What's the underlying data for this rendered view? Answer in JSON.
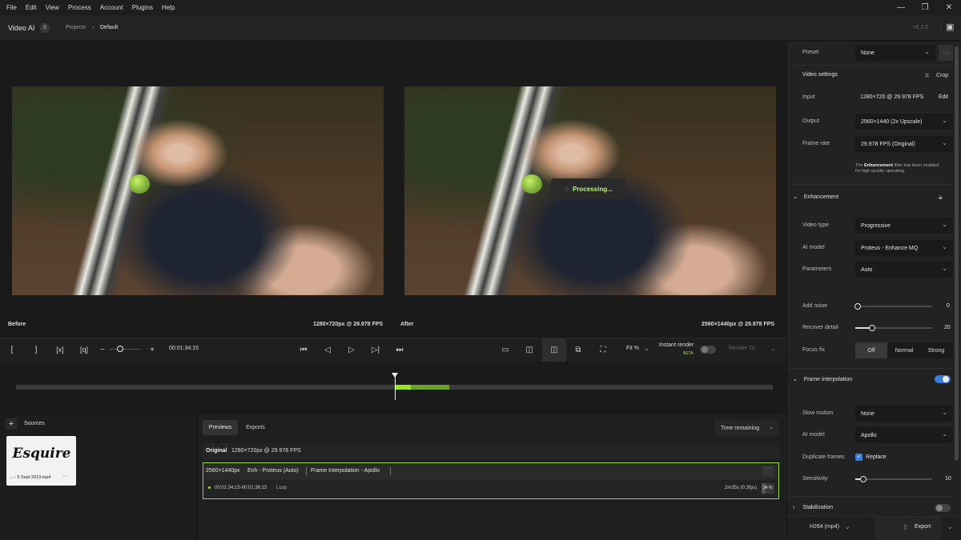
{
  "menu": [
    "File",
    "Edit",
    "View",
    "Process",
    "Account",
    "Plugins",
    "Help"
  ],
  "app": {
    "title": "Video AI",
    "badge": "5",
    "version": "v5.2.0"
  },
  "breadcrumb": {
    "projects": "Projects",
    "current": "Default"
  },
  "viewer": {
    "before_label": "Before",
    "before_res": "1280×720px @ 29.978 FPS",
    "after_label": "After",
    "after_res": "2560×1440px @ 29.978 FPS",
    "processing": "Processing..."
  },
  "controls": {
    "timecode": "00:01:34;15",
    "fit": "Fit %",
    "instant_render": "Instant render",
    "beta": "BETA",
    "render": "Render 2s"
  },
  "timeline": {
    "playhead": 0.5,
    "processed_fraction": 0.3
  },
  "sources": {
    "title": "Sources",
    "file": "... - 5 Sept 2013.mp4",
    "thumb_text": "Esquire"
  },
  "queue": {
    "tabs": [
      "Previews",
      "Exports"
    ],
    "sort": "Time remaining",
    "original_label": "Original",
    "original_res": "1280×720px @ 29.978 FPS",
    "job_res": "2560×1440px",
    "job_enh": "Enh - Proteus (Auto)",
    "job_fi": "Frame Interpolation - Apollo",
    "job_range": "00:01:34;15-00:01:36;15",
    "job_loop": "Loop",
    "job_eta": "2m35s (0.3fps)",
    "job_pct": "34 %",
    "job_progress": 0.34
  },
  "panel": {
    "preset_label": "Preset",
    "preset_value": "None",
    "video_settings": "Video settings",
    "crop": "Crop",
    "input_label": "Input",
    "input_value": "1280×720 @ 29.978 FPS",
    "edit": "Edit",
    "output_label": "Output",
    "output_value": "2560×1440 (2x Upscale)",
    "framerate_label": "Frame rate",
    "framerate_value": "29.978 FPS (Original)",
    "note_pre": "The ",
    "note_bold": "Enhancement",
    "note_post": " filter has been enabled",
    "note_line2": "for high-quality upscaling.",
    "enhancement": "Enhancement",
    "video_type_label": "Video type",
    "video_type_value": "Progressive",
    "ai_model_label": "AI model",
    "ai_model_value": "Proteus - Enhance MQ",
    "parameters_label": "Parameters",
    "parameters_value": "Auto",
    "add_noise_label": "Add noise",
    "add_noise_value": "0",
    "recover_detail_label": "Recover detail",
    "recover_detail_value": "20",
    "focus_fix_label": "Focus fix",
    "focus_options": [
      "Off",
      "Normal",
      "Strong"
    ],
    "frame_interp": "Frame interpolation",
    "slow_motion_label": "Slow motion",
    "slow_motion_value": "None",
    "fi_model_label": "AI model",
    "fi_model_value": "Apollo",
    "dup_label": "Duplicate frames",
    "dup_value": "Replace",
    "sensitivity_label": "Sensitivity",
    "sensitivity_value": "10",
    "stabilization": "Stabilization",
    "codec": "H264 (mp4)",
    "export": "Export"
  },
  "colors": {
    "accent_green": "#9be22a",
    "toggle_blue": "#3d7bd9",
    "checkbox_blue": "#3d7bd9"
  }
}
